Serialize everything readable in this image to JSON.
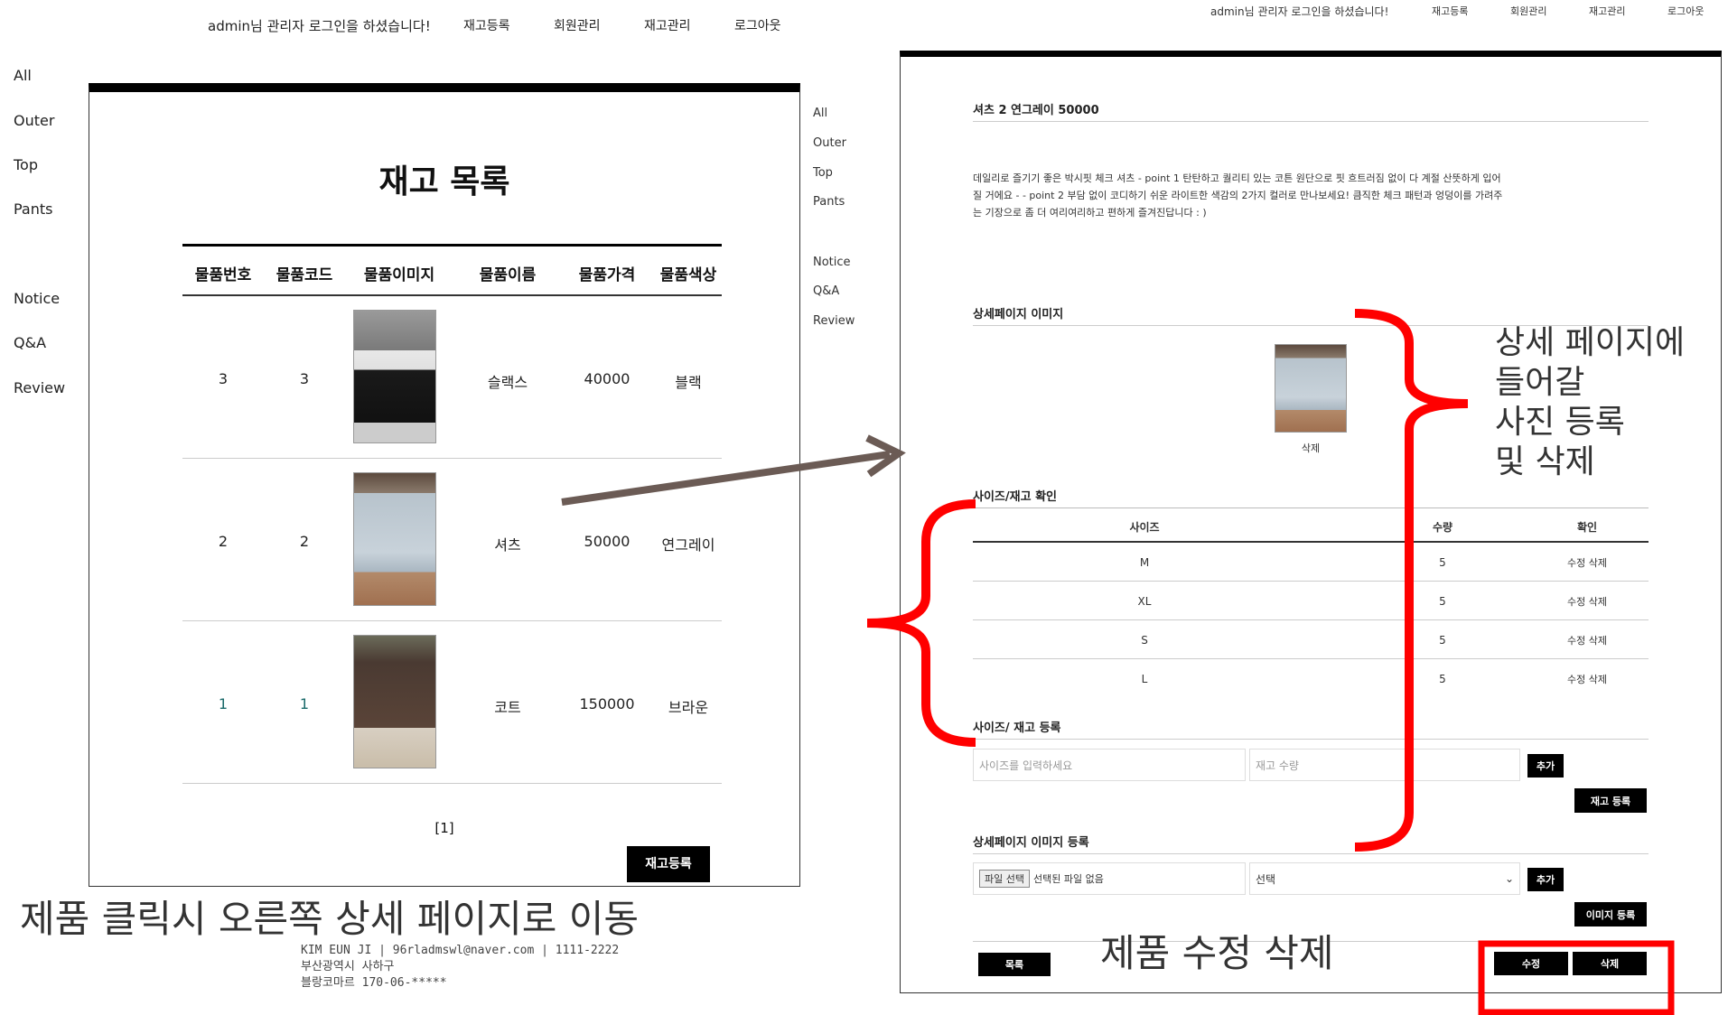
{
  "left": {
    "topbar": {
      "greeting": "admin님 관리자 로그인을 하셨습니다!",
      "nav": [
        "재고등록",
        "회원관리",
        "재고관리",
        "로그아웃"
      ]
    },
    "categories": [
      "All",
      "Outer",
      "Top",
      "Pants",
      "Notice",
      "Q&A",
      "Review"
    ],
    "title": "재고 목록",
    "table": {
      "headers": [
        "물품번호",
        "물품코드",
        "물품이미지",
        "물품이름",
        "물품가격",
        "물품색상"
      ],
      "rows": [
        {
          "no": "3",
          "code": "3",
          "name": "슬랙스",
          "price": "40000",
          "color": "블랙"
        },
        {
          "no": "2",
          "code": "2",
          "name": "셔츠",
          "price": "50000",
          "color": "연그레이"
        },
        {
          "no": "1",
          "code": "1",
          "name": "코트",
          "price": "150000",
          "color": "브라운"
        }
      ]
    },
    "pagination": "[1]",
    "register_button": "재고등록",
    "footer": {
      "line1": "KIM EUN JI | 96rladmswl@naver.com | 1111-2222",
      "line2": "부산광역시 사하구",
      "line3": "블랑코마르 170-06-*****"
    }
  },
  "right": {
    "topbar": {
      "greeting": "admin님 관리자 로그인을 하셨습니다!",
      "nav": [
        "재고등록",
        "회원관리",
        "재고관리",
        "로그아웃"
      ]
    },
    "categories": [
      "All",
      "Outer",
      "Top",
      "Pants",
      "Notice",
      "Q&A",
      "Review"
    ],
    "product_title": "셔츠 2 연그레이 50000",
    "description": [
      "데일리로 즐기기 좋은 박시핏 체크 셔츠 - point 1 탄탄하고 퀄리티 있는 코튼 원단으로 핏 흐트러짐 없이 다 계절 산뜻하게 입어",
      "질 거에요 - - point 2 부담 없이 코디하기 쉬운 라이트한 색감의 2가지 컬러로 만나보세요! 큼직한 체크 패턴과 엉덩이를 가려주",
      "는 기장으로 좀 더 여리여리하고 편하게 즐겨진답니다 : )"
    ],
    "detail_image_section": "상세페이지 이미지",
    "detail_image_delete": "삭제",
    "stock_section": "사이즈/재고 확인",
    "stock_table": {
      "headers": [
        "사이즈",
        "수량",
        "확인"
      ],
      "rows": [
        {
          "size": "M",
          "qty": "5",
          "action": "수정 삭제"
        },
        {
          "size": "XL",
          "qty": "5",
          "action": "수정 삭제"
        },
        {
          "size": "S",
          "qty": "5",
          "action": "수정 삭제"
        },
        {
          "size": "L",
          "qty": "5",
          "action": "수정 삭제"
        }
      ]
    },
    "stock_register_section": "사이즈/ 재고 등록",
    "size_placeholder": "사이즈를 입력하세요",
    "qty_placeholder": "재고 수량",
    "add_button": "추가",
    "stock_register_button": "재고 등록",
    "image_register_section": "상세페이지 이미지 등록",
    "file_button": "파일 선택",
    "file_status": "선택된 파일 없음",
    "select_value": "선택",
    "add_button2": "추가",
    "image_register_button": "이미지 등록",
    "list_button": "목록",
    "edit_button": "수정",
    "delete_button": "삭제"
  },
  "annotations": {
    "bottom_left": "제품 클릭시 오른쪽 상세 페이지로 이동",
    "bottom_right": "제품 수정 삭제",
    "right_side": [
      "상세 페이지에",
      "들어갈",
      "사진 등록",
      "및 삭제"
    ]
  },
  "colors": {
    "annotation_red": "#ff0000",
    "arrow": "#6b5b55"
  }
}
